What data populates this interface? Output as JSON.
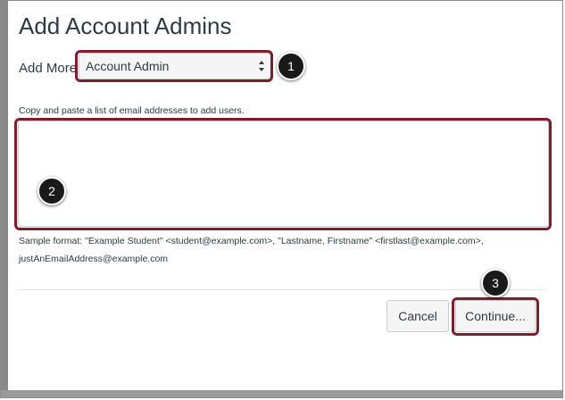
{
  "dialog": {
    "title": "Add Account Admins",
    "add_more_label": "Add More",
    "role_select_value": "Account Admin",
    "help_text": "Copy and paste a list of email addresses to add users.",
    "sample_line_1": "Sample format: \"Example Student\" <student@example.com>, \"Lastname, Firstname\" <firstlast@example.com>,",
    "sample_line_2": "justAnEmailAddress@example.com",
    "cancel_label": "Cancel",
    "continue_label": "Continue..."
  },
  "annotations": {
    "markers": [
      "1",
      "2",
      "3"
    ],
    "highlight_color": "#7a1f2b"
  }
}
